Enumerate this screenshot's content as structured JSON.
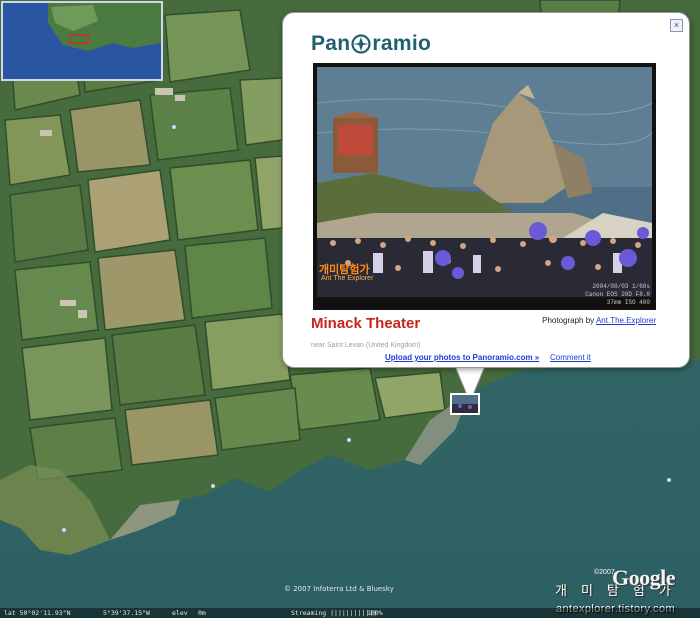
{
  "balloon": {
    "logo_text": [
      "Pan",
      "ramio"
    ],
    "close_label": "×",
    "photo": {
      "watermark_kr": "개미탐험가",
      "watermark_author": "Ant The Explorer",
      "stamp_lines": [
        "2004/08/03      1/60s",
        "Canon EOS 20D     F8.0",
        "37mm    ISO 400"
      ]
    },
    "title": "Minack Theater",
    "credit_prefix": "Photograph by",
    "credit_author": "Ant.The.Explorer",
    "near_text": "near Saint Levan (United Kingdom)",
    "upload_link": "Upload your photos to Panoramio.com »",
    "comment_link": "Comment it"
  },
  "map": {
    "copyright": "© 2007 Infoterra Ltd & Bluesky",
    "google_copyright": "©2007",
    "google_logo": "Google",
    "watermark_kr": "개미탐험가",
    "watermark_blog": "antexplorer.tistory.com"
  },
  "status_bar": {
    "pointer": "lat  50°02'11.93\"N",
    "lon": "5°39'37.15\"W",
    "elev_label": "elev",
    "elev_value": "0m",
    "streaming_label": "Streaming ||||||||||||",
    "streaming_pct": "100%"
  },
  "colors": {
    "accent_title": "#c4261b",
    "link": "#1b3dd1",
    "logo": "#1f5f6f"
  }
}
